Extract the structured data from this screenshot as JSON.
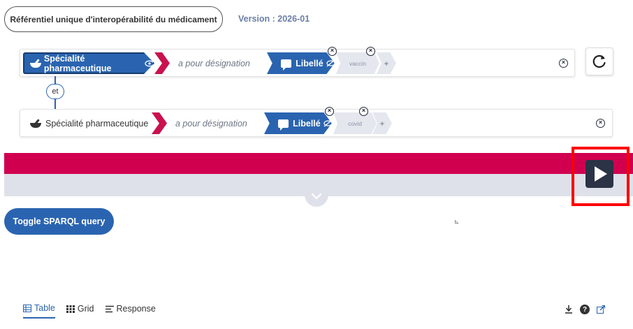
{
  "header": {
    "title": "Référentiel unique d'interopérabilité du médicament",
    "version": "Version : 2026-01"
  },
  "query": {
    "rows": [
      {
        "class_label": "Spécialité pharmaceutique",
        "property_label": "a pour désignation",
        "target_label": "Libellé",
        "value": "vaccin",
        "add": "+"
      },
      {
        "class_label": "Spécialité pharmaceutique",
        "property_label": "a pour désignation",
        "target_label": "Libellé",
        "value": "covid",
        "add": "+"
      }
    ],
    "connector": "et"
  },
  "buttons": {
    "toggle_sparql": "Toggle SPARQL query"
  },
  "results": {
    "tabs": [
      {
        "label": "Table",
        "icon": "table-icon",
        "active": true
      },
      {
        "label": "Grid",
        "icon": "grid-icon",
        "active": false
      },
      {
        "label": "Response",
        "icon": "response-icon",
        "active": false
      }
    ]
  },
  "colors": {
    "accent_blue": "#2a64b0",
    "band_red": "#d0004f",
    "band_gray": "#dfe1ea",
    "play_dark": "#2b3346",
    "highlight": "#ff0000"
  }
}
